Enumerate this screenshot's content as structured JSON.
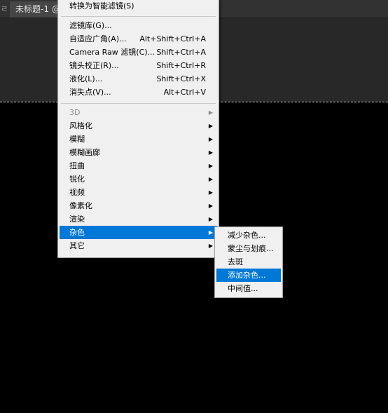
{
  "tabs": {
    "prev_separator": "ㄹ",
    "doc_tab": "未标题-1 @"
  },
  "filter_menu": {
    "top_item": {
      "label": "转换为智能滤镜(S)"
    },
    "group2": [
      {
        "label": "滤镜库(G)...",
        "shortcut": ""
      },
      {
        "label": "自适应广角(A)...",
        "shortcut": "Alt+Shift+Ctrl+A"
      },
      {
        "label": "Camera Raw 滤镜(C)...",
        "shortcut": "Shift+Ctrl+A"
      },
      {
        "label": "镜头校正(R)...",
        "shortcut": "Shift+Ctrl+R"
      },
      {
        "label": "液化(L)...",
        "shortcut": "Shift+Ctrl+X"
      },
      {
        "label": "消失点(V)...",
        "shortcut": "Alt+Ctrl+V"
      }
    ],
    "submenus": [
      {
        "label": "3D",
        "disabled": true
      },
      {
        "label": "风格化"
      },
      {
        "label": "模糊"
      },
      {
        "label": "模糊画廊"
      },
      {
        "label": "扭曲"
      },
      {
        "label": "锐化"
      },
      {
        "label": "视频"
      },
      {
        "label": "像素化"
      },
      {
        "label": "渲染"
      },
      {
        "label": "杂色",
        "highlighted": true
      },
      {
        "label": "其它"
      }
    ],
    "arrow": "▶"
  },
  "noise_submenu": {
    "items": [
      {
        "label": "减少杂色..."
      },
      {
        "label": "蒙尘与划痕..."
      },
      {
        "label": "去斑"
      },
      {
        "label": "添加杂色...",
        "highlighted": true
      },
      {
        "label": "中间值..."
      }
    ]
  },
  "colors": {
    "highlight": "#0078d7",
    "menu_bg": "#f0f0f0",
    "panel_bg": "#282828",
    "canvas": "#000000"
  }
}
